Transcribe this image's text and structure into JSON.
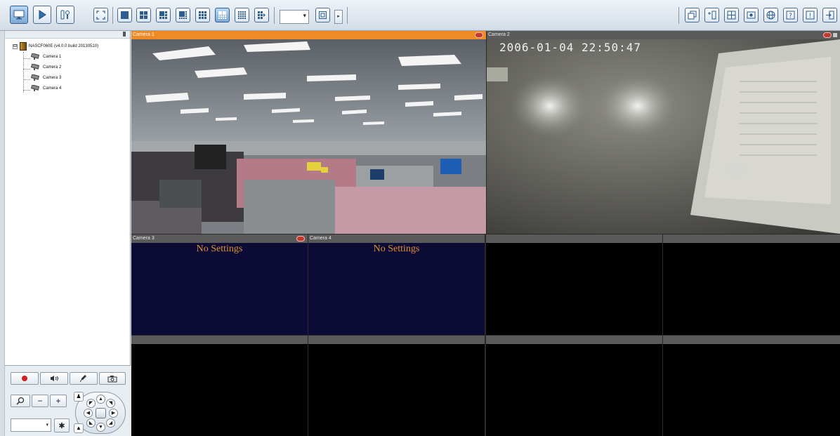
{
  "toolbar": {
    "left_buttons": [
      "monitor-icon",
      "playback-icon",
      "settings-icon"
    ],
    "layout_buttons": [
      "fullscreen-icon",
      "layout-1-icon",
      "layout-4-icon",
      "layout-6-icon",
      "layout-8-icon",
      "layout-9-icon",
      "layout-10-icon",
      "layout-16-icon",
      "layout-sequence-icon"
    ],
    "active_layout": "layout-10-icon",
    "view_dropdown_value": "",
    "right_buttons": [
      "window-icon",
      "channel-icon",
      "grid-icon",
      "snapshot-icon",
      "globe-icon",
      "help-icon",
      "info-icon",
      "logout-icon"
    ]
  },
  "tree": {
    "root_expander": "⊟",
    "root_label": "NASCF060E (v4.0.0 build 20130510)",
    "cameras": [
      "Camera 1",
      "Camera 2",
      "Camera 3",
      "Camera 4"
    ]
  },
  "tiles": {
    "t1_title": "Camera 1",
    "t2_title": "Camera 2",
    "t2_osd": "2006-01-04 22:50:47",
    "t3_title": "Camera 3",
    "t3_message": "No Settings",
    "t4_title": "Camera 4",
    "t4_message": "No Settings"
  },
  "colors": {
    "selected_title_bar": "#f08a24",
    "no_settings_text": "#e0902e",
    "no_settings_bg": "#0b0b36"
  },
  "controls": {
    "record_icon": "record-icon",
    "audio_icon": "speaker-icon",
    "talk_icon": "microphone-icon",
    "snapshot_icon": "camera-icon",
    "zoom_label": "zoom-icon",
    "minus": "−",
    "plus": "+",
    "preset_value": ""
  }
}
